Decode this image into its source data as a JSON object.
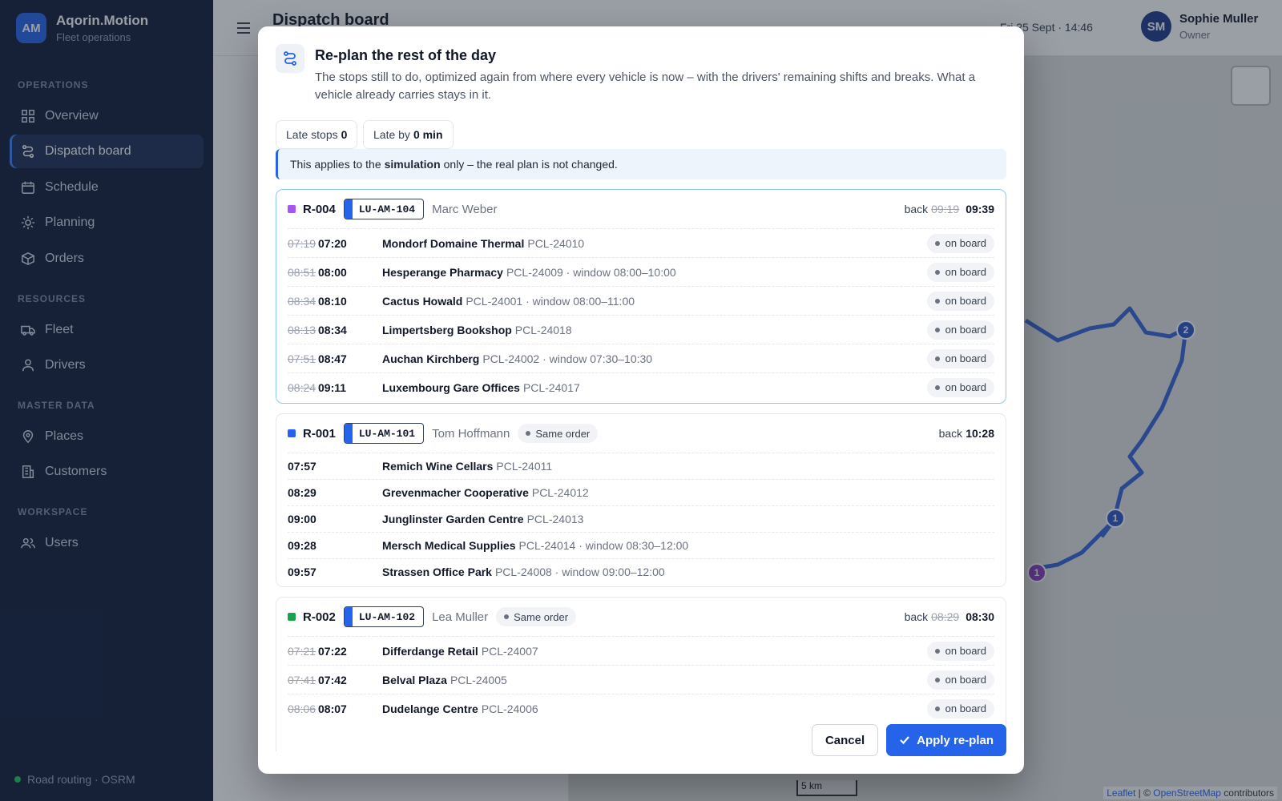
{
  "brand": {
    "initials": "AM",
    "name": "Aqorin.Motion",
    "subtitle": "Fleet operations"
  },
  "sidebar": {
    "sections": [
      {
        "label": "OPERATIONS"
      },
      {
        "label": "RESOURCES"
      },
      {
        "label": "MASTER DATA"
      },
      {
        "label": "WORKSPACE"
      }
    ],
    "items": [
      {
        "label": "Overview",
        "icon": "grid-icon"
      },
      {
        "label": "Dispatch board",
        "icon": "route-icon",
        "active": true
      },
      {
        "label": "Schedule",
        "icon": "calendar-icon"
      },
      {
        "label": "Planning",
        "icon": "sun-icon"
      },
      {
        "label": "Orders",
        "icon": "box-icon"
      },
      {
        "label": "Fleet",
        "icon": "truck-icon"
      },
      {
        "label": "Drivers",
        "icon": "person-icon"
      },
      {
        "label": "Places",
        "icon": "pin-icon"
      },
      {
        "label": "Customers",
        "icon": "building-icon"
      },
      {
        "label": "Users",
        "icon": "users-icon"
      }
    ],
    "footer": "Road routing · OSRM"
  },
  "header": {
    "title": "Dispatch board",
    "date": "Fri 25 Sept · 14:46",
    "user": {
      "initials": "SM",
      "name": "Sophie Muller",
      "role": "Owner"
    }
  },
  "map": {
    "scale": "5 km",
    "credit_leaflet": "Leaflet",
    "credit_sep": " | © ",
    "credit_osm": "OpenStreetMap",
    "credit_tail": " contributors"
  },
  "modal": {
    "title": "Re-plan the rest of the day",
    "description": "The stops still to do, optimized again from where every vehicle is now – with the drivers' remaining shifts and breaks. What a vehicle already carries stays in it.",
    "late_stops_label": "Late stops",
    "late_stops_value": "0",
    "late_by_label": "Late by",
    "late_by_value": "0 min",
    "notice_pre": "This applies to the",
    "notice_bold": "simulation",
    "notice_post": "only – the real plan is not changed.",
    "back_label": "back",
    "same_order_label": "Same order",
    "on_board_label": "on board",
    "cancel": "Cancel",
    "apply": "Apply re-plan",
    "routes": [
      {
        "code": "R-004",
        "color": "#a855f7",
        "plate": "LU-AM-104",
        "driver": "Marc Weber",
        "back_old": "09:19",
        "back_new": "09:39",
        "same_order": false,
        "stops": [
          {
            "old": "07:19",
            "new": "07:20",
            "name": "Mondorf Domaine Thermal",
            "meta": "PCL-24010",
            "on_board": true
          },
          {
            "old": "08:51",
            "new": "08:00",
            "name": "Hesperange Pharmacy",
            "meta": "PCL-24009 · window 08:00–10:00",
            "on_board": true
          },
          {
            "old": "08:34",
            "new": "08:10",
            "name": "Cactus Howald",
            "meta": "PCL-24001 · window 08:00–11:00",
            "on_board": true
          },
          {
            "old": "08:13",
            "new": "08:34",
            "name": "Limpertsberg Bookshop",
            "meta": "PCL-24018",
            "on_board": true
          },
          {
            "old": "07:51",
            "new": "08:47",
            "name": "Auchan Kirchberg",
            "meta": "PCL-24002 · window 07:30–10:30",
            "on_board": true
          },
          {
            "old": "08:24",
            "new": "09:11",
            "name": "Luxembourg Gare Offices",
            "meta": "PCL-24017",
            "on_board": true
          }
        ]
      },
      {
        "code": "R-001",
        "color": "#2563eb",
        "plate": "LU-AM-101",
        "driver": "Tom Hoffmann",
        "back_old": "",
        "back_new": "10:28",
        "same_order": true,
        "stops": [
          {
            "old": "",
            "new": "07:57",
            "name": "Remich Wine Cellars",
            "meta": "PCL-24011",
            "on_board": false
          },
          {
            "old": "",
            "new": "08:29",
            "name": "Grevenmacher Cooperative",
            "meta": "PCL-24012",
            "on_board": false
          },
          {
            "old": "",
            "new": "09:00",
            "name": "Junglinster Garden Centre",
            "meta": "PCL-24013",
            "on_board": false
          },
          {
            "old": "",
            "new": "09:28",
            "name": "Mersch Medical Supplies",
            "meta": "PCL-24014 · window 08:30–12:00",
            "on_board": false
          },
          {
            "old": "",
            "new": "09:57",
            "name": "Strassen Office Park",
            "meta": "PCL-24008 · window 09:00–12:00",
            "on_board": false
          }
        ]
      },
      {
        "code": "R-002",
        "color": "#16a34a",
        "plate": "LU-AM-102",
        "driver": "Lea Muller",
        "back_old": "08:29",
        "back_new": "08:30",
        "same_order": true,
        "stops": [
          {
            "old": "07:21",
            "new": "07:22",
            "name": "Differdange Retail",
            "meta": "PCL-24007",
            "on_board": true
          },
          {
            "old": "07:41",
            "new": "07:42",
            "name": "Belval Plaza",
            "meta": "PCL-24005",
            "on_board": true
          },
          {
            "old": "08:06",
            "new": "08:07",
            "name": "Dudelange Centre",
            "meta": "PCL-24006",
            "on_board": true
          }
        ]
      }
    ]
  }
}
